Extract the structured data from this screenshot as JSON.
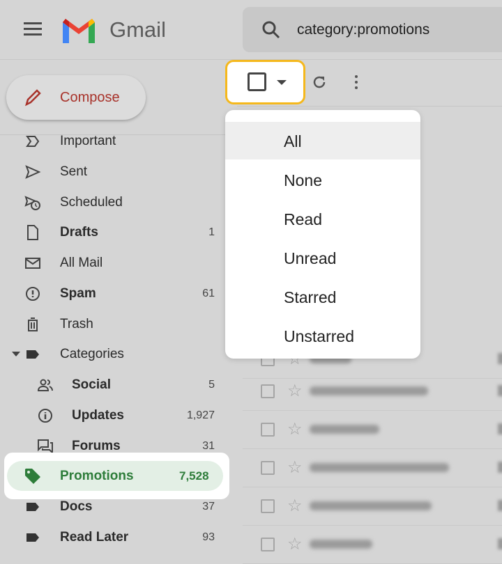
{
  "header": {
    "brand": "Gmail",
    "search_value": "category:promotions"
  },
  "compose": {
    "label": "Compose"
  },
  "sidebar": {
    "items": [
      {
        "label": "Important",
        "icon": "important-icon",
        "count": "",
        "bold": false
      },
      {
        "label": "Sent",
        "icon": "send-icon",
        "count": "",
        "bold": false
      },
      {
        "label": "Scheduled",
        "icon": "scheduled-icon",
        "count": "",
        "bold": false
      },
      {
        "label": "Drafts",
        "icon": "draft-icon",
        "count": "1",
        "bold": true
      },
      {
        "label": "All Mail",
        "icon": "mail-icon",
        "count": "",
        "bold": false
      },
      {
        "label": "Spam",
        "icon": "spam-icon",
        "count": "61",
        "bold": true
      },
      {
        "label": "Trash",
        "icon": "trash-icon",
        "count": "",
        "bold": false
      },
      {
        "label": "Categories",
        "icon": "label-icon",
        "count": "",
        "bold": false
      },
      {
        "label": "Social",
        "icon": "social-icon",
        "count": "5",
        "bold": true
      },
      {
        "label": "Updates",
        "icon": "info-icon",
        "count": "1,927",
        "bold": true
      },
      {
        "label": "Forums",
        "icon": "forum-icon",
        "count": "31",
        "bold": true
      },
      {
        "label": "Promotions",
        "icon": "tag-icon",
        "count": "7,528",
        "bold": true,
        "selected": true
      },
      {
        "label": "Docs",
        "icon": "label-icon",
        "count": "37",
        "bold": true
      },
      {
        "label": "Read Later",
        "icon": "label-icon",
        "count": "93",
        "bold": true
      }
    ]
  },
  "select_menu": {
    "items": [
      "All",
      "None",
      "Read",
      "Unread",
      "Starred",
      "Unstarred"
    ],
    "hovered": "All"
  },
  "colors": {
    "highlight_border": "#f5b81c",
    "promotions_green": "#2e7d3a",
    "compose_red": "#a8322a"
  }
}
